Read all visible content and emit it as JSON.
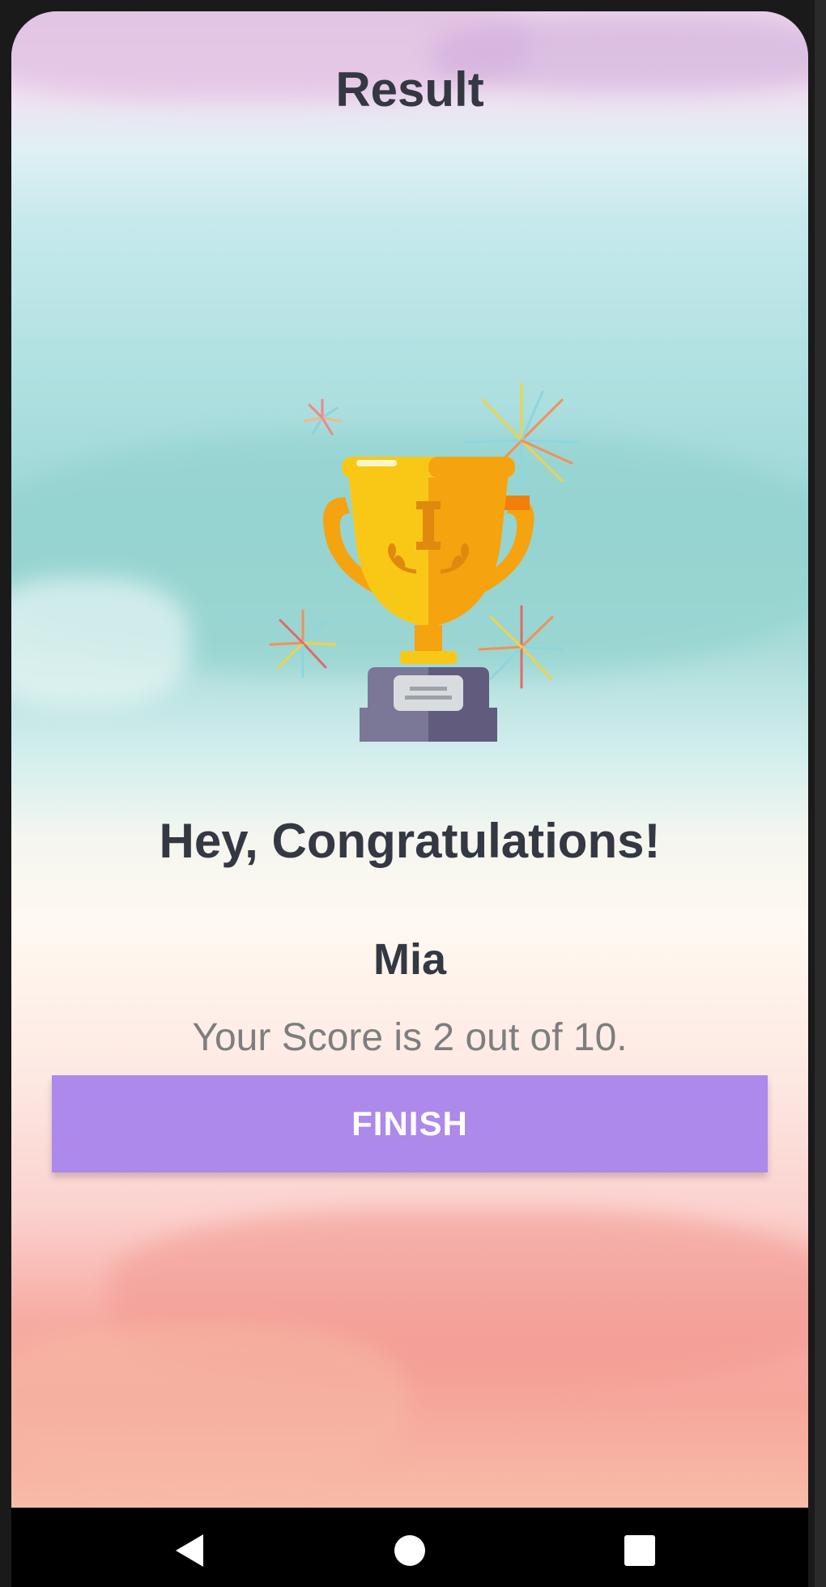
{
  "header": {
    "title": "Result"
  },
  "result": {
    "congratulations_text": "Hey, Congratulations!",
    "user_name": "Mia",
    "score_text": "Your Score is 2 out of 10."
  },
  "actions": {
    "finish_label": "FINISH"
  },
  "icons": {
    "trophy": "trophy-icon",
    "back": "back-triangle-icon",
    "home": "home-circle-icon",
    "recent": "recent-apps-square-icon"
  },
  "colors": {
    "accent_button": "#ac89ea",
    "title_text": "#343843",
    "score_text": "#7e7e7e",
    "trophy_gold": "#f9c817",
    "trophy_orange": "#f5a30f",
    "trophy_base": "#6b6788"
  }
}
